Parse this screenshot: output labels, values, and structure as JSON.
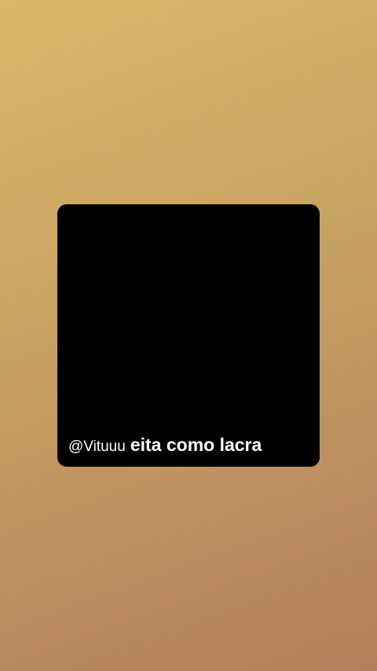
{
  "story": {
    "background_colors": [
      "#d8b86a",
      "#b07f5c"
    ],
    "card_color": "#000000",
    "reply": {
      "username": "@Vituuu",
      "message": "eita como lacra"
    }
  }
}
